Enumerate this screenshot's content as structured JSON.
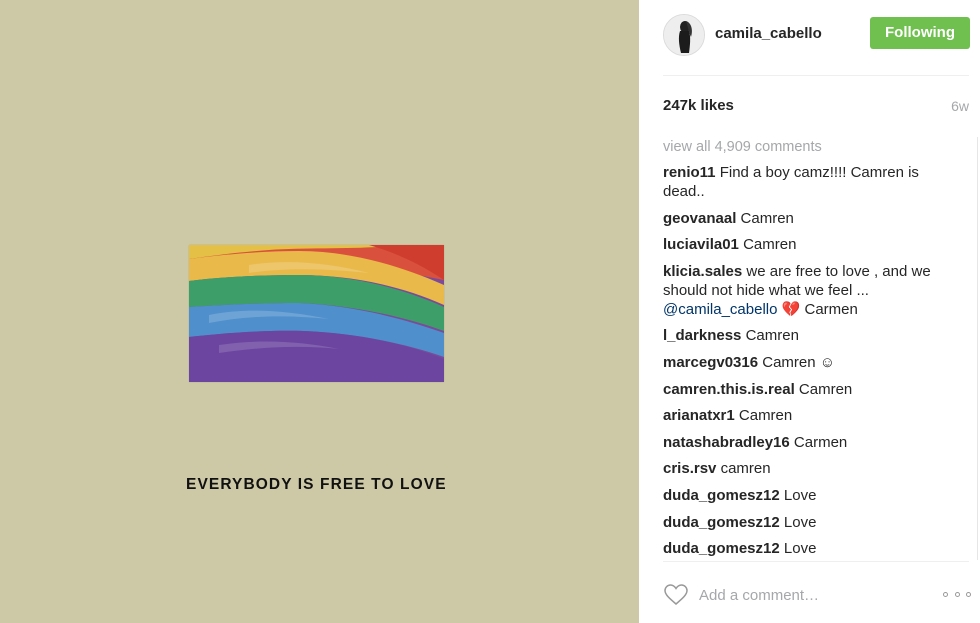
{
  "post": {
    "caption_text": "EVERYBODY IS FREE TO LOVE",
    "background_color": "#cdc9a7",
    "image_icon": "rainbow-flag-image"
  },
  "header": {
    "username": "camila_cabello",
    "follow_label": "Following",
    "follow_color": "#70c050"
  },
  "stats": {
    "likes": "247k likes",
    "age": "6w"
  },
  "comments_section": {
    "view_all": "view all 4,909 comments",
    "items": [
      {
        "user": "renio11",
        "text": "Find a boy camz!!!! Camren is dead.."
      },
      {
        "user": "geovanaal",
        "text": "Camren"
      },
      {
        "user": "luciavila01",
        "text": "Camren"
      },
      {
        "user": "klicia.sales",
        "text": "we are free to love , and we should not hide what we feel ...",
        "mention": "@camila_cabello",
        "suffix_emoji": "💔",
        "suffix_text": "Carmen"
      },
      {
        "user": "l_darkness",
        "text": "Camren"
      },
      {
        "user": "marcegv0316",
        "text": "Camren",
        "suffix_emoji": "☺"
      },
      {
        "user": "camren.this.is.real",
        "text": "Camren"
      },
      {
        "user": "arianatxr1",
        "text": "Camren"
      },
      {
        "user": "natashabradley16",
        "text": "Carmen"
      },
      {
        "user": "cris.rsv",
        "text": "camren"
      },
      {
        "user": "duda_gomesz12",
        "text": "Love"
      },
      {
        "user": "duda_gomesz12",
        "text": "Love"
      },
      {
        "user": "duda_gomesz12",
        "text": "Love"
      }
    ]
  },
  "footer": {
    "comment_placeholder": "Add a comment…",
    "like_icon": "heart-icon",
    "more_icon": "more-options-icon"
  }
}
